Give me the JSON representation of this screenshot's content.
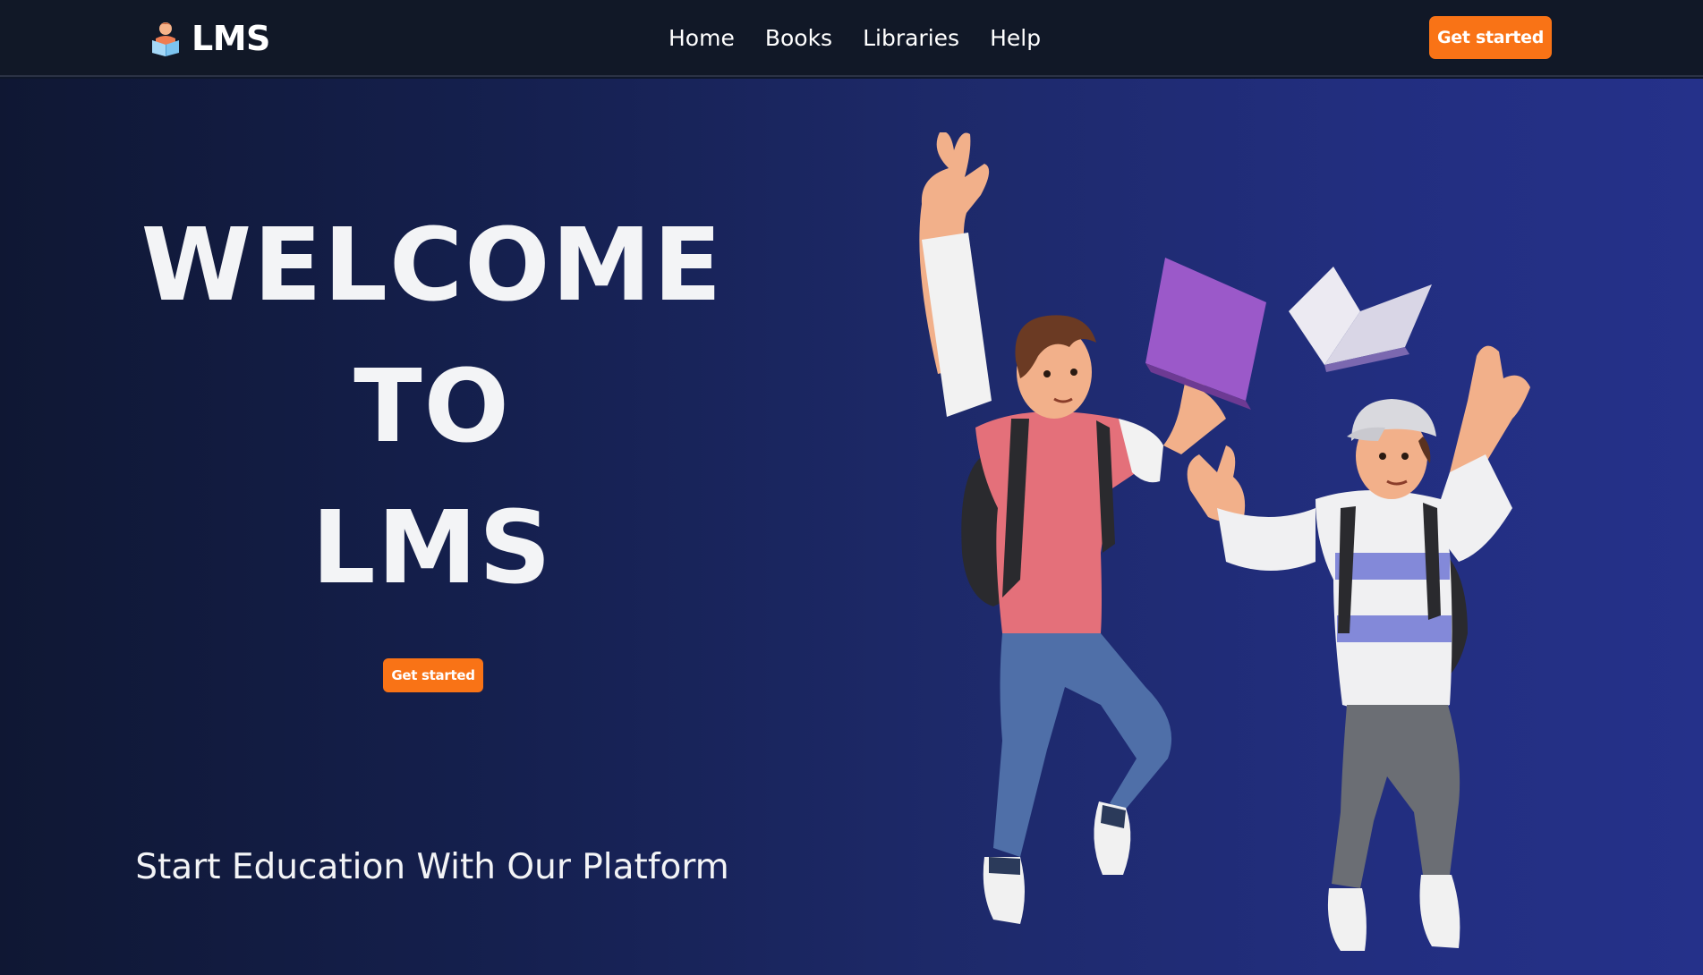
{
  "navbar": {
    "brand": "LMS",
    "brand_icon": "reading-student-icon",
    "links": [
      "Home",
      "Books",
      "Libraries",
      "Help"
    ],
    "cta_label": "Get started"
  },
  "hero": {
    "title_lines": [
      "WELCOME",
      "TO",
      "LMS"
    ],
    "cta_label": "Get started",
    "subtitle": "Start Education With Our Platform",
    "illustration": "two-jumping-students-with-books"
  },
  "colors": {
    "navbar_bg": "#111827",
    "hero_bg_start": "#0f1733",
    "hero_bg_end": "#25318a",
    "accent": "#f97316",
    "text": "#ffffff"
  }
}
